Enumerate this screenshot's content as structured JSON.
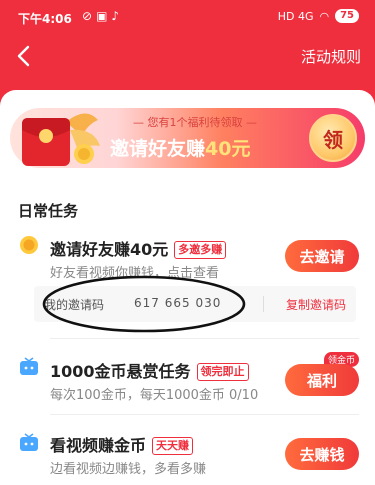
{
  "status_bar": {
    "time": "下午4:06",
    "left_icons": [
      "alarm-off-icon",
      "camera-icon",
      "social-icon"
    ],
    "signal": "HD 4G",
    "battery": "75"
  },
  "header": {
    "back_icon": "chevron-left-icon",
    "rules_label": "活动规则",
    "bg_color": "#ef2f3e"
  },
  "banner": {
    "tag": "您有1个福利待领取",
    "title_prefix": "邀请好友赚",
    "title_amount": "40元",
    "button_label": "领"
  },
  "section_title": "日常任务",
  "tasks": [
    {
      "icon": "coin-icon",
      "title": "邀请好友赚40元",
      "tag": "多邀多赚",
      "desc": "好友看视频你赚钱，点击查看",
      "button": "去邀请"
    },
    {
      "icon": "tv-icon",
      "title": "1000金币悬赏任务",
      "tag": "领完即止",
      "desc": "每次100金币，每天1000金币 0/10",
      "button": "福利",
      "badge": "领金币"
    },
    {
      "icon": "tv-icon",
      "title": "看视频赚金币",
      "tag": "天天赚",
      "desc": "边看视频边赚钱，多看多赚",
      "button": "去赚钱"
    }
  ],
  "invite": {
    "label": "我的邀请码",
    "code": "617 665 030",
    "copy_label": "复制邀请码"
  }
}
